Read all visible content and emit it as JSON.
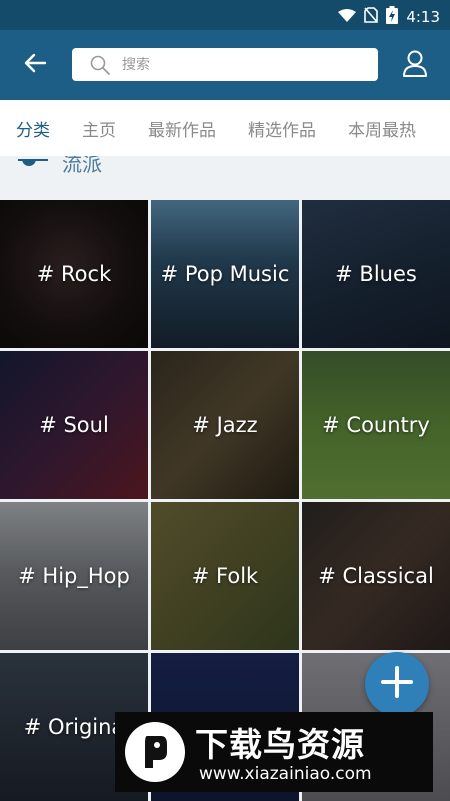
{
  "status_bar": {
    "time": "4:13"
  },
  "search": {
    "placeholder": "搜索"
  },
  "tabs": [
    {
      "label": "分类",
      "active": true
    },
    {
      "label": "主页"
    },
    {
      "label": "最新作品"
    },
    {
      "label": "精选作品"
    },
    {
      "label": "本周最热"
    }
  ],
  "section": {
    "title": "流派"
  },
  "genres": [
    {
      "label": "# Rock"
    },
    {
      "label": "# Pop Music"
    },
    {
      "label": "# Blues"
    },
    {
      "label": "# Soul"
    },
    {
      "label": "# Jazz"
    },
    {
      "label": "# Country"
    },
    {
      "label": "# Hip_Hop"
    },
    {
      "label": "# Folk"
    },
    {
      "label": "# Classical"
    },
    {
      "label": "# Origina"
    }
  ],
  "watermark": {
    "title": "下载鸟资源",
    "url": "www.xiazainiao.com"
  },
  "colors": {
    "app_bar": "#1d5e86",
    "status_bar": "#144a6a",
    "accent": "#1d5e86",
    "fab": "#2f7fb8"
  }
}
